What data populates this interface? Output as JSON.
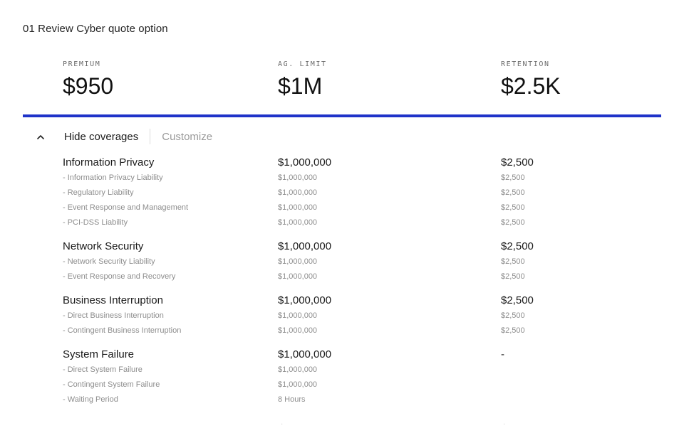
{
  "page_title": "01 Review Cyber quote option",
  "summary": [
    {
      "label": "PREMIUM",
      "value": "$950"
    },
    {
      "label": "AG. LIMIT",
      "value": "$1M"
    },
    {
      "label": "RETENTION",
      "value": "$2.5K"
    }
  ],
  "colors": {
    "accent": "#1f33c9"
  },
  "toggle": {
    "icon": "chevron-up-icon",
    "hide_label": "Hide coverages",
    "customize_label": "Customize"
  },
  "coverages": [
    {
      "name": "Information Privacy",
      "limit": "$1,000,000",
      "retention": "$2,500",
      "items": [
        {
          "name": "- Information Privacy Liability",
          "limit": "$1,000,000",
          "retention": "$2,500"
        },
        {
          "name": "- Regulatory Liability",
          "limit": "$1,000,000",
          "retention": "$2,500"
        },
        {
          "name": "- Event Response and Management",
          "limit": "$1,000,000",
          "retention": "$2,500"
        },
        {
          "name": "- PCI-DSS Liability",
          "limit": "$1,000,000",
          "retention": "$2,500"
        }
      ]
    },
    {
      "name": "Network Security",
      "limit": "$1,000,000",
      "retention": "$2,500",
      "items": [
        {
          "name": "- Network Security Liability",
          "limit": "$1,000,000",
          "retention": "$2,500"
        },
        {
          "name": "- Event Response and Recovery",
          "limit": "$1,000,000",
          "retention": "$2,500"
        }
      ]
    },
    {
      "name": "Business Interruption",
      "limit": "$1,000,000",
      "retention": "$2,500",
      "items": [
        {
          "name": "- Direct Business Interruption",
          "limit": "$1,000,000",
          "retention": "$2,500"
        },
        {
          "name": "- Contingent Business Interruption",
          "limit": "$1,000,000",
          "retention": "$2,500"
        }
      ]
    },
    {
      "name": "System Failure",
      "limit": "$1,000,000",
      "retention": "-",
      "items": [
        {
          "name": "- Direct System Failure",
          "limit": "$1,000,000",
          "retention": ""
        },
        {
          "name": "- Contingent System Failure",
          "limit": "$1,000,000",
          "retention": ""
        },
        {
          "name": "- Waiting Period",
          "limit": "8 Hours",
          "retention": ""
        }
      ]
    }
  ],
  "partial_row": {
    "c1": "",
    "c2": "·",
    "c3": "·"
  }
}
